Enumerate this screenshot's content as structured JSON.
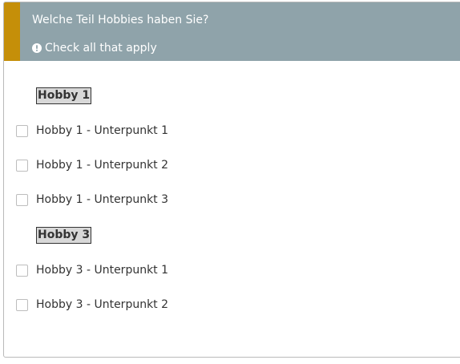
{
  "question": {
    "title": "Welche Teil Hobbies haben Sie?",
    "hint_icon": "exclamation-circle-icon",
    "hint": "Check all that apply"
  },
  "groups": [
    {
      "label": "Hobby 1",
      "options": [
        {
          "label": "Hobby 1 - Unterpunkt 1",
          "checked": false
        },
        {
          "label": "Hobby 1 - Unterpunkt 2",
          "checked": false
        },
        {
          "label": "Hobby 1 - Unterpunkt 3",
          "checked": false
        }
      ]
    },
    {
      "label": "Hobby 3",
      "options": [
        {
          "label": "Hobby 3 - Unterpunkt 1",
          "checked": false
        },
        {
          "label": "Hobby 3 - Unterpunkt 2",
          "checked": false
        }
      ]
    }
  ],
  "colors": {
    "header_bg": "#8fa3aa",
    "accent": "#c58f09",
    "text": "#333333",
    "group_label_bg": "#d8d8d8"
  }
}
